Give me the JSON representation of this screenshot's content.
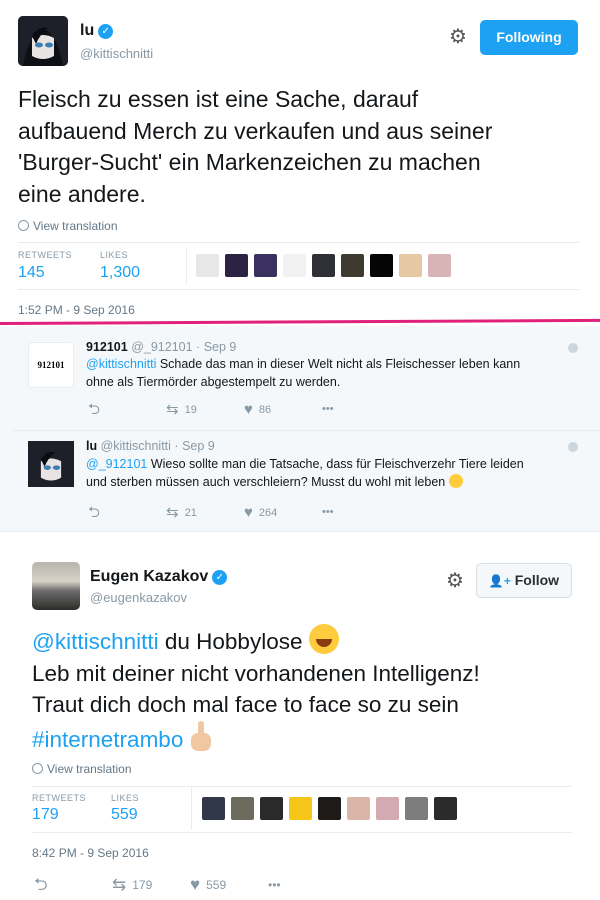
{
  "tweet1": {
    "author_name": "lu",
    "handle": "@kittischnitti",
    "following_label": "Following",
    "text_lines": [
      "Fleisch zu essen ist eine Sache, darauf",
      "aufbauend Merch zu verkaufen und aus seiner",
      "'Burger-Sucht' ein Markenzeichen zu machen",
      "eine andere."
    ],
    "view_translation": "View translation",
    "retweets_label": "RETWEETS",
    "retweets_count": "145",
    "likes_label": "LIKES",
    "likes_count": "1,300",
    "liker_colors": [
      "#e9e6e6",
      "#2c2344",
      "#3b3160",
      "#f2f2f2",
      "#2f2f36",
      "#3e3a30",
      "#050505",
      "#e6c9a4",
      "#d9b4b7"
    ],
    "timestamp": "1:52 PM - 9 Sep 2016"
  },
  "replies": [
    {
      "name": "912101",
      "handle": "@_912101",
      "date": "Sep 9",
      "avatar_text": "912101",
      "mention": "@kittischnitti",
      "text_line1": " Schade das man in dieser Welt nicht als Fleischesser leben kann",
      "text_line2": "ohne als Tiermörder abgestempelt zu werden.",
      "retweets": "19",
      "likes": "86"
    },
    {
      "name": "lu",
      "handle": "@kittischnitti",
      "date": "Sep 9",
      "mention": "@_912101",
      "text_line1": " Wieso sollte man die Tatsache, dass für Fleischverzehr Tiere leiden",
      "text_line2": "und sterben müssen auch verschleiern? Musst du wohl mit leben",
      "retweets": "21",
      "likes": "264"
    }
  ],
  "tweet2": {
    "author_name": "Eugen Kazakov",
    "handle": "@eugenkazakov",
    "follow_label": "Follow",
    "line1_mention": "@kittischnitti",
    "line1_text": " du Hobbylose",
    "line2": "Leb mit deiner nicht vorhandenen Intelligenz!",
    "line3": "Traut dich doch mal face to face so zu sein",
    "hashtag": "#internetrambo",
    "view_translation": "View translation",
    "retweets_label": "RETWEETS",
    "retweets_count": "179",
    "likes_label": "LIKES",
    "likes_count": "559",
    "liker_colors": [
      "#31384a",
      "#6d6a5e",
      "#2a2a2a",
      "#f5c518",
      "#1d1a18",
      "#d9b6a8",
      "#d3aab2",
      "#7e7d7b",
      "#2b2b2b"
    ],
    "timestamp": "8:42 PM - 9 Sep 2016",
    "action_retweets": "179",
    "action_likes": "559"
  },
  "icons": {
    "verified": "✓",
    "gear": "⚙",
    "reply": "⮌",
    "retweet": "⇆",
    "like": "♥",
    "more": "•••",
    "follow_add_user": "👤+"
  },
  "colors": {
    "accent": "#1da1f2",
    "divider_pink": "#e0207b",
    "reply_bg": "#f5f8fa"
  }
}
